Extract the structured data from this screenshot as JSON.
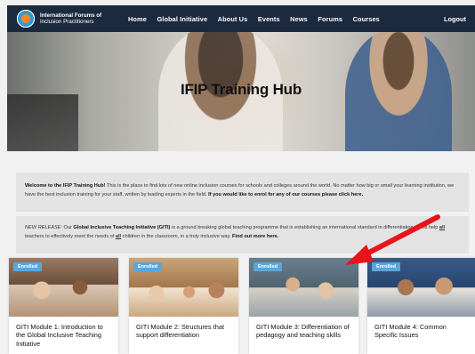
{
  "nav": {
    "brand_line1": "International Forums of",
    "brand_line2": "Inclusion Practitioners",
    "logo_text": "IFIP",
    "items": [
      {
        "label": "Home"
      },
      {
        "label": "Global Initiative"
      },
      {
        "label": "About Us"
      },
      {
        "label": "Events"
      },
      {
        "label": "News"
      },
      {
        "label": "Forums"
      },
      {
        "label": "Courses"
      }
    ],
    "logout": "Logout"
  },
  "hero": {
    "title": "IFIP Training Hub"
  },
  "welcome": {
    "lead": "Welcome to the IFIP Training Hub!",
    "body": " This is the place to find lots of new online inclusion courses for schools and colleges around the world. No matter how big or small your learning institution, we have the best inclusion training for your staff, written by leading experts in the field. ",
    "cta": "If you would like to enrol for any of our courses please click here."
  },
  "release": {
    "tag": "NEW RELEASE:",
    "t1": " Our ",
    "name": "Global Inclusive Teaching Initiative (GITI)",
    "t2": " is a ground breaking global teaching programme that is establishing an international standard in differentiation. It will help ",
    "all1": "all",
    "t3": " teachers to effectively meet the needs of ",
    "all2": "all",
    "t4": " children in the classroom, in a truly inclusive way. ",
    "cta": "Find out more here."
  },
  "courses": [
    {
      "badge": "Enrolled",
      "title": "GITI Module 1: Introduction to the Global Inclusive Teaching Initiative"
    },
    {
      "badge": "Enrolled",
      "title": "GITI Module 2: Structures that support differentiation"
    },
    {
      "badge": "Enrolled",
      "title": "GITI Module 3: Differentiation of pedagogy and teaching skills"
    },
    {
      "badge": "Enrolled",
      "title": "GITI Module 4: Common Specific Issues"
    }
  ],
  "colors": {
    "nav_bg": "#1b2a3f",
    "badge": "#5ba6d9",
    "arrow": "#e8141c"
  }
}
